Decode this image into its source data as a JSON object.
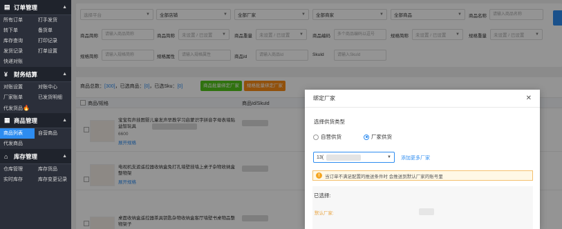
{
  "sidebar": {
    "sections": [
      {
        "title": "订单管理",
        "icon": "order-icon",
        "items": [
          "所有订单",
          "打手发货",
          "转下单",
          "备货单",
          "库存查询",
          "打印记录",
          "发货记录",
          "打单设置",
          "快递对账"
        ]
      },
      {
        "title": "财务结算",
        "icon": "yen-icon",
        "items": [
          "对账设置",
          "对账中心",
          "厂家账单",
          "已发货明细",
          "代发货品"
        ]
      },
      {
        "title": "商品管理",
        "icon": "grid-icon",
        "items": [
          "商品列表",
          "自营商品",
          "代发商品"
        ]
      },
      {
        "title": "库存管理",
        "icon": "home-icon",
        "items": [
          "仓库管理",
          "库存货品",
          "实时库存",
          "库存变更记录"
        ]
      }
    ]
  },
  "filters": {
    "row1": {
      "platform_placeholder": "选择平台",
      "store": "全部店铺",
      "factory": "全部厂家",
      "merchant": "全部商家",
      "goods": "全部商品",
      "goods_name_label": "商品名称",
      "goods_name_placeholder": "请输入商品名称"
    },
    "row2": {
      "short_label": "商品简称",
      "short_placeholder": "请输入商品简称",
      "short_select_label": "商品简称",
      "unset_or_set": "未设置 / 已设置",
      "weight_label": "商品重量",
      "weight_value": "未设置 / 已设置",
      "code_label": "商品编码",
      "code_placeholder": "多个商品编码以逗号",
      "spec_short_label": "规格简称",
      "spec_short_value": "未设置 / 已设置",
      "spec_weight_label": "规格重量",
      "spec_weight_value": "未设置 / 已设置"
    },
    "row3": {
      "spec_short_label": "规格简称",
      "spec_short_placeholder": "请输入规格简称",
      "spec_attr_label": "规格属性",
      "spec_attr_placeholder": "请输入规格属性",
      "goods_id_label": "商品Id",
      "goods_id_placeholder": "请输入商品Id",
      "skuid_label": "SkuId",
      "skuid_placeholder": "请输入SkuId"
    }
  },
  "products": {
    "summary_prefix": "商品总数：",
    "total": "[300]",
    "selected_label": "，已选商品：",
    "selected": "[0]",
    "sku_label": "，已选Sku：",
    "sku_selected": "[0]",
    "batch_bind_button": "商品批量绑定厂家",
    "spec_bind_button": "规格批量绑定厂家",
    "col_goods": "商品/规格",
    "col_id": "商品Id/SkuId",
    "rows": [
      {
        "title": "宝宝有声挂图婴儿童发声早教学习启蒙识字拼音字母表墙贴益智玩具",
        "meta": "6600",
        "expand": "展开规格"
      },
      {
        "title": "电视机支遮遥控器收纳盒免打孔墙壁挂墙上桌子杂物收纳盒整物架",
        "meta": "",
        "expand": "展开规格"
      },
      {
        "title": "桌面收纳盒遥控器茶具钥匙杂物收纳盒客厅墙壁书桌物品整物架子",
        "meta": "",
        "expand": ""
      }
    ]
  },
  "modal": {
    "title": "绑定厂家",
    "close": "✕",
    "supply_type_label": "选择供货类型",
    "option_self": "自营供货",
    "option_factory": "厂家供货",
    "selected_option": "factory",
    "factory_select_value": "13(",
    "add_more_link": "添加更多厂家",
    "warning": "当订单不满足配置的推送条件时 会推送到默认厂家的账号里",
    "selected_title": "已选择:",
    "default_factory_label": "默认厂家:"
  }
}
